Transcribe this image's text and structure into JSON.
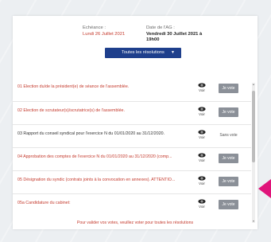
{
  "header": {
    "echeance_label": "Echéance :",
    "echeance_value": "Lundi 26 Juillet 2021",
    "ag_label": "Date de l'AG :",
    "ag_value_line1": "Vendredi 30 Juillet 2021 à",
    "ag_value_line2": "19h00"
  },
  "filter": {
    "label": "Toutes les résolutions",
    "icon": "chevron-down-icon"
  },
  "resolutions": [
    {
      "title": "01 Election du/de la président(e) de séance de l'assemblée.",
      "voir": "Voir",
      "action": "Je vote"
    },
    {
      "title": "02 Election de scrutateur(s)/scrutatrice(s) de l'assemblée.",
      "voir": "Voir",
      "action": "Je vote"
    },
    {
      "title": "03 Rapport du conseil syndical pour l'exercice N du 01/01/2020 au 31/12/2020.",
      "voir": "Voir",
      "action": "Sans vote"
    },
    {
      "title": "04 Approbation des comptes de l'exercice N du 01/01/2020 au 31/12/2020 (comp...",
      "voir": "Voir",
      "action": "Je vote"
    },
    {
      "title": "05 Désignation du syndic (contrats joints à la convocation en annexes). ATTENTIO...",
      "voir": "Voir",
      "action": "Je vote"
    },
    {
      "title": "05a Candidature du cabinet:",
      "voir": "Voir",
      "action": "Je vote"
    }
  ],
  "footer_message": "Pour valider vos votes, veuillez voter pour toutes les résolutions",
  "colors": {
    "accent_red": "#c4392c",
    "filter_blue": "#1e3f8c",
    "button_gray": "#8b9098",
    "pointer_pink": "#e0147a"
  }
}
